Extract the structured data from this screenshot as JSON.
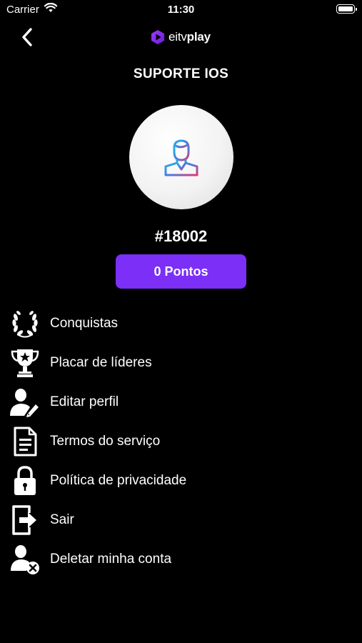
{
  "status_bar": {
    "carrier": "Carrier",
    "time": "11:30"
  },
  "header": {
    "logo_prefix": "eitv",
    "logo_suffix": "play",
    "accent_color": "#7b2ff7"
  },
  "profile": {
    "title": "SUPORTE IOS",
    "user_id": "#18002",
    "points_label": "0 Pontos",
    "avatar_icon": "user-avatar-icon"
  },
  "menu": {
    "items": [
      {
        "label": "Conquistas",
        "icon": "laurel-icon"
      },
      {
        "label": "Placar de líderes",
        "icon": "trophy-icon"
      },
      {
        "label": "Editar perfil",
        "icon": "edit-profile-icon"
      },
      {
        "label": "Termos do serviço",
        "icon": "document-icon"
      },
      {
        "label": "Política de privacidade",
        "icon": "lock-icon"
      },
      {
        "label": "Sair",
        "icon": "logout-icon"
      },
      {
        "label": "Deletar minha conta",
        "icon": "delete-user-icon"
      }
    ]
  }
}
